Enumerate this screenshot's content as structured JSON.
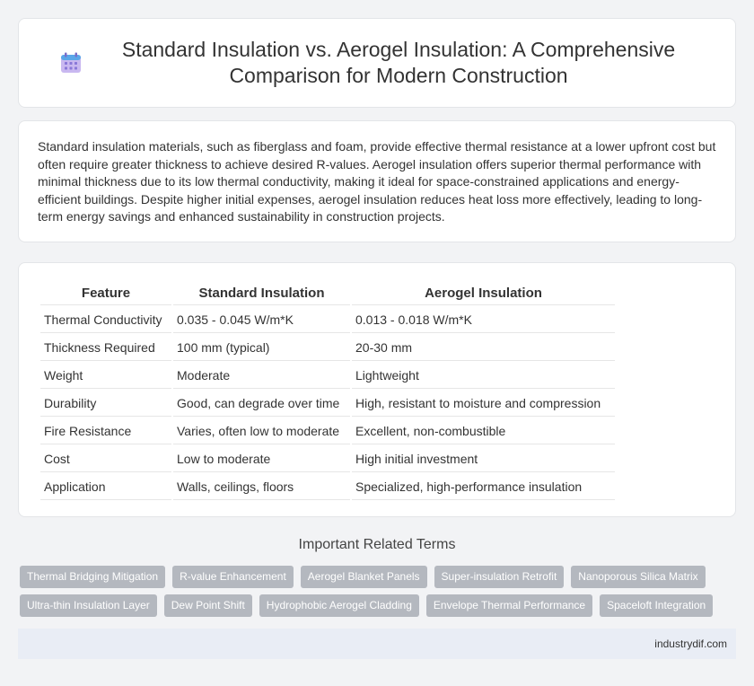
{
  "header": {
    "title": "Standard Insulation vs. Aerogel Insulation: A Comprehensive Comparison for Modern Construction",
    "icon": "calendar-icon"
  },
  "description": "Standard insulation materials, such as fiberglass and foam, provide effective thermal resistance at a lower upfront cost but often require greater thickness to achieve desired R-values. Aerogel insulation offers superior thermal performance with minimal thickness due to its low thermal conductivity, making it ideal for space-constrained applications and energy-efficient buildings. Despite higher initial expenses, aerogel insulation reduces heat loss more effectively, leading to long-term energy savings and enhanced sustainability in construction projects.",
  "table": {
    "headers": [
      "Feature",
      "Standard Insulation",
      "Aerogel Insulation"
    ],
    "rows": [
      [
        "Thermal Conductivity",
        "0.035 - 0.045 W/m*K",
        "0.013 - 0.018 W/m*K"
      ],
      [
        "Thickness Required",
        "100 mm (typical)",
        "20-30 mm"
      ],
      [
        "Weight",
        "Moderate",
        "Lightweight"
      ],
      [
        "Durability",
        "Good, can degrade over time",
        "High, resistant to moisture and compression"
      ],
      [
        "Fire Resistance",
        "Varies, often low to moderate",
        "Excellent, non-combustible"
      ],
      [
        "Cost",
        "Low to moderate",
        "High initial investment"
      ],
      [
        "Application",
        "Walls, ceilings, floors",
        "Specialized, high-performance insulation"
      ]
    ]
  },
  "related": {
    "heading": "Important Related Terms",
    "rows": [
      [
        "Thermal Bridging Mitigation",
        "R-value Enhancement",
        "Aerogel Blanket Panels",
        "Super-insulation Retrofit",
        "Nanoporous Silica Matrix"
      ],
      [
        "Ultra-thin Insulation Layer",
        "Dew Point Shift",
        "Hydrophobic Aerogel Cladding",
        "Envelope Thermal Performance",
        "Spaceloft Integration"
      ]
    ]
  },
  "footer": {
    "site": "industrydif.com"
  }
}
